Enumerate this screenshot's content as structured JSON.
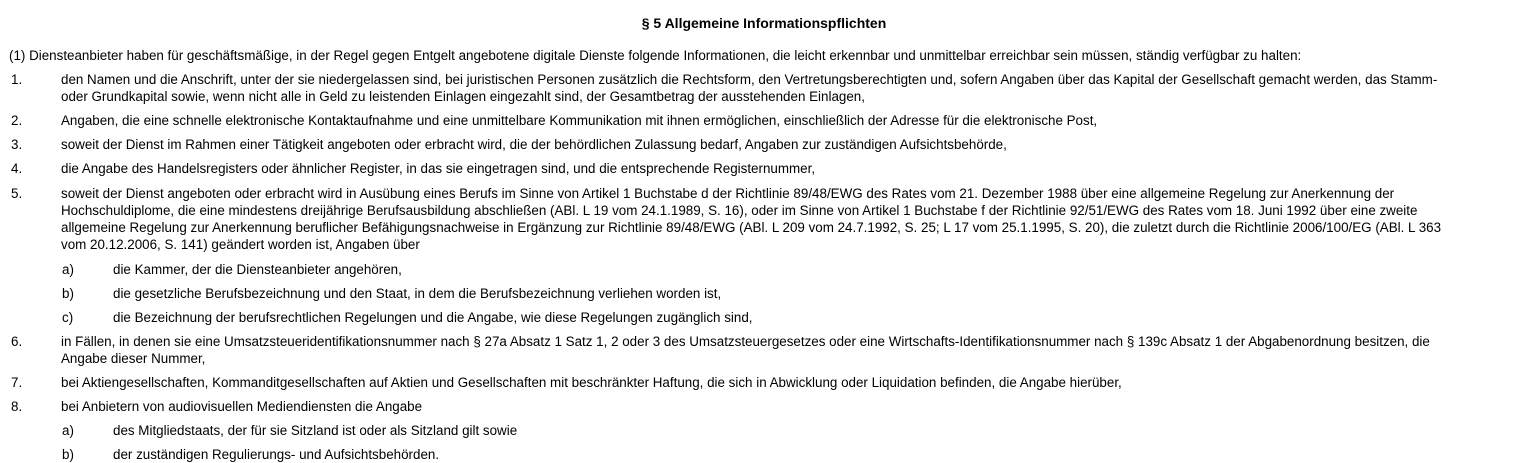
{
  "title": "§ 5 Allgemeine Informationspflichten",
  "intro": "(1) Diensteanbieter haben für geschäftsmäßige, in der Regel gegen Entgelt angebotene digitale Dienste folgende Informationen, die leicht erkennbar und unmittelbar erreichbar sein müssen, ständig verfügbar zu halten:",
  "items": [
    {
      "num": "1.",
      "lines": [
        "den Namen und die Anschrift, unter der sie niedergelassen sind, bei juristischen Personen zusätzlich die Rechtsform, den Vertretungsberechtigten und, sofern Angaben über das Kapital der Gesellschaft gemacht werden, das Stamm-",
        "oder Grundkapital sowie, wenn nicht alle in Geld zu leistenden Einlagen eingezahlt sind, der Gesamtbetrag der ausstehenden Einlagen,"
      ]
    },
    {
      "num": "2.",
      "lines": [
        "Angaben, die eine schnelle elektronische Kontaktaufnahme und eine unmittelbare Kommunikation mit ihnen ermöglichen, einschließlich der Adresse für die elektronische Post,"
      ]
    },
    {
      "num": "3.",
      "lines": [
        "soweit der Dienst im Rahmen einer Tätigkeit angeboten oder erbracht wird, die der behördlichen Zulassung bedarf, Angaben zur zuständigen Aufsichtsbehörde,"
      ]
    },
    {
      "num": "4.",
      "lines": [
        "die Angabe des Handelsregisters oder ähnlicher Register, in das sie eingetragen sind, und die entsprechende Registernummer,"
      ]
    },
    {
      "num": "5.",
      "lines": [
        "soweit der Dienst angeboten oder erbracht wird in Ausübung eines Berufs im Sinne von Artikel 1 Buchstabe d der Richtlinie 89/48/EWG des Rates vom 21. Dezember 1988 über eine allgemeine Regelung zur Anerkennung der",
        "Hochschuldiplome, die eine mindestens dreijährige Berufsausbildung abschließen (ABl. L 19 vom 24.1.1989, S. 16), oder im Sinne von Artikel 1 Buchstabe f der Richtlinie 92/51/EWG des Rates vom 18. Juni 1992 über eine zweite",
        "allgemeine Regelung zur Anerkennung beruflicher Befähigungsnachweise in Ergänzung zur Richtlinie 89/48/EWG (ABl. L 209 vom 24.7.1992, S. 25; L 17 vom 25.1.1995, S. 20), die zuletzt durch die Richtlinie 2006/100/EG (ABl. L 363",
        "vom 20.12.2006, S. 141) geändert worden ist, Angaben über"
      ],
      "sub": [
        {
          "label": "a)",
          "text": "die Kammer, der die Diensteanbieter angehören,"
        },
        {
          "label": "b)",
          "text": "die gesetzliche Berufsbezeichnung und den Staat, in dem die Berufsbezeichnung verliehen worden ist,"
        },
        {
          "label": "c)",
          "text": "die Bezeichnung der berufsrechtlichen Regelungen und die Angabe, wie diese Regelungen zugänglich sind,"
        }
      ]
    },
    {
      "num": "6.",
      "lines": [
        "in Fällen, in denen sie eine Umsatzsteueridentifikationsnummer nach § 27a Absatz 1 Satz 1, 2 oder 3 des Umsatzsteuergesetzes oder eine Wirtschafts-Identifikationsnummer nach § 139c Absatz 1 der Abgabenordnung besitzen, die",
        "Angabe dieser Nummer,"
      ]
    },
    {
      "num": "7.",
      "lines": [
        "bei Aktiengesellschaften, Kommanditgesellschaften auf Aktien und Gesellschaften mit beschränkter Haftung, die sich in Abwicklung oder Liquidation befinden, die Angabe hierüber,"
      ]
    },
    {
      "num": "8.",
      "lines": [
        "bei Anbietern von audiovisuellen Mediendiensten die Angabe"
      ],
      "sub": [
        {
          "label": "a)",
          "text": "des Mitgliedstaats, der für sie Sitzland ist oder als Sitzland gilt sowie"
        },
        {
          "label": "b)",
          "text": "der zuständigen Regulierungs- und Aufsichtsbehörden."
        }
      ]
    }
  ]
}
